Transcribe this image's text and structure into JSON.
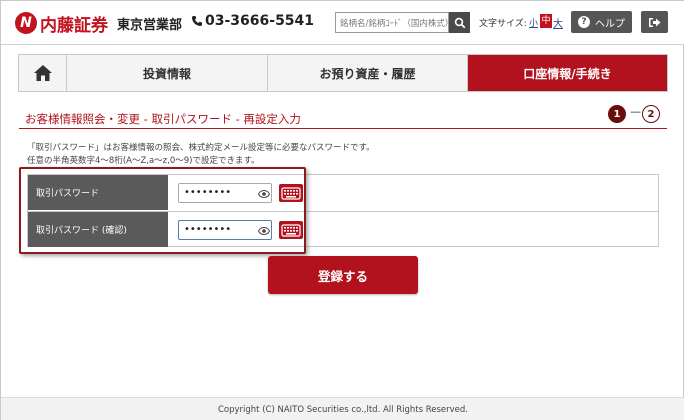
{
  "header": {
    "logo_mark": "N",
    "logo_text": "内藤証券",
    "branch": "東京営業部",
    "phone": "03-3666-5541",
    "search_placeholder": "銘柄名/銘柄ｺｰﾄﾞ（国内株式）",
    "font_size_label": "文字サイズ:",
    "font_small": "小",
    "font_mid": "中",
    "font_large": "大",
    "help_label": "ヘルプ",
    "brand_color": "#b1121d"
  },
  "nav": {
    "home_icon": "home-icon",
    "items": [
      {
        "label": "投資情報"
      },
      {
        "label": "お預り資産・履歴"
      },
      {
        "label": "口座情報/手続き"
      }
    ]
  },
  "page": {
    "title": "お客様情報照会・変更 - 取引パスワード - 再設定入力",
    "step1": "1",
    "step_sep": "—",
    "step2": "2",
    "desc_line1": "「取引パスワード」はお客様情報の照会、株式約定メール設定等に必要なパスワードです。",
    "desc_line2": "任意の半角英数字4～8桁(A～Z,a～z,0～9)で設定できます。"
  },
  "form": {
    "rows": [
      {
        "label": "取引パスワード",
        "value": "••••••••"
      },
      {
        "label": "取引パスワード (確認)",
        "value": "••••••••"
      }
    ],
    "submit_label": "登録する"
  },
  "footer": {
    "copyright": "Copyright (C) NAITO Securities co.,ltd. All Rights Reserved."
  }
}
